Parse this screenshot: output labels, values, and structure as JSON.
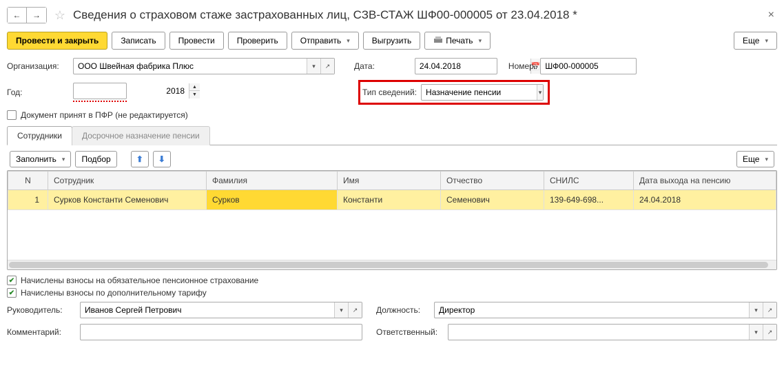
{
  "title": "Сведения о страховом стаже застрахованных лиц, СЗВ-СТАЖ ШФ00-000005 от 23.04.2018 *",
  "toolbar": {
    "post_close": "Провести и закрыть",
    "save": "Записать",
    "post": "Провести",
    "check": "Проверить",
    "send": "Отправить",
    "export": "Выгрузить",
    "print": "Печать",
    "more": "Еще"
  },
  "labels": {
    "org": "Организация:",
    "date": "Дата:",
    "number": "Номер:",
    "year": "Год:",
    "info_type": "Тип сведений:",
    "accepted": "Документ принят в ПФР (не редактируется)",
    "chk1": "Начислены взносы на обязательное пенсионное страхование",
    "chk2": "Начислены взносы по дополнительному тарифу",
    "head": "Руководитель:",
    "position": "Должность:",
    "comment": "Комментарий:",
    "responsible": "Ответственный:"
  },
  "fields": {
    "org": "ООО Швейная фабрика Плюс",
    "date": "24.04.2018",
    "number": "ШФ00-000005",
    "year": "2018",
    "info_type": "Назначение пенсии",
    "head": "Иванов Сергей Петрович",
    "position": "Директор",
    "comment": "",
    "responsible": ""
  },
  "tabs": {
    "employees": "Сотрудники",
    "early": "Досрочное назначение пенсии"
  },
  "table_toolbar": {
    "fill": "Заполнить",
    "pick": "Подбор",
    "more": "Еще"
  },
  "columns": {
    "n": "N",
    "employee": "Сотрудник",
    "surname": "Фамилия",
    "name": "Имя",
    "patronymic": "Отчество",
    "snils": "СНИЛС",
    "retire_date": "Дата выхода на пенсию"
  },
  "rows": [
    {
      "n": "1",
      "employee": "Сурков Константи Семенович",
      "surname": "Сурков",
      "name": "Константи",
      "patronymic": "Семенович",
      "snils": "139-649-698...",
      "retire_date": "24.04.2018"
    }
  ]
}
